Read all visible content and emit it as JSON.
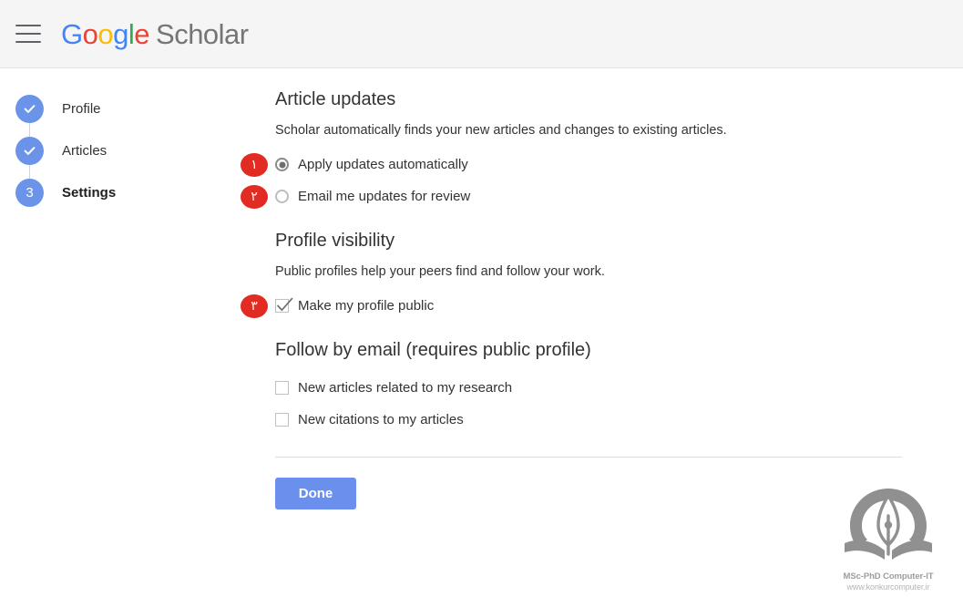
{
  "header": {
    "menu_icon": "hamburger-menu-icon",
    "logo": {
      "word_google": "Google",
      "g1": "G",
      "o1": "o",
      "o2": "o",
      "g2": "g",
      "l": "l",
      "e": "e",
      "scholar": "Scholar"
    },
    "colors": {
      "blue": "#4285f4",
      "red": "#ea4335",
      "yellow": "#fbbc05",
      "green": "#34a853",
      "scholar_gray": "#757575",
      "bar_bg": "#f5f5f5"
    }
  },
  "stepper": {
    "steps": [
      {
        "label": "Profile",
        "state": "complete",
        "marker": "check-icon",
        "active": false
      },
      {
        "label": "Articles",
        "state": "complete",
        "marker": "check-icon",
        "active": false
      },
      {
        "label": "Settings",
        "state": "current",
        "marker": "3",
        "active": true
      }
    ],
    "circle_color": "#6b94e8"
  },
  "main": {
    "article_updates": {
      "title": "Article updates",
      "description": "Scholar automatically finds your new articles and changes to existing articles.",
      "options": [
        {
          "label": "Apply updates automatically",
          "selected": true,
          "badge": "١"
        },
        {
          "label": "Email me updates for review",
          "selected": false,
          "badge": "٢"
        }
      ]
    },
    "profile_visibility": {
      "title": "Profile visibility",
      "description": "Public profiles help your peers find and follow your work.",
      "checkbox": {
        "label": "Make my profile public",
        "checked": true,
        "badge": "٣"
      }
    },
    "follow_by_email": {
      "title": "Follow by email (requires public profile)",
      "checkboxes": [
        {
          "label": "New articles related to my research",
          "checked": false
        },
        {
          "label": "New citations to my articles",
          "checked": false
        }
      ]
    },
    "done_label": "Done",
    "done_color": "#6b8fec",
    "badge_color": "#e22b22"
  },
  "watermark": {
    "logo_icon": "pen-nib-book-logo-icon",
    "title": "MSc-PhD Computer-IT",
    "url": "www.konkurcomputer.ir"
  }
}
